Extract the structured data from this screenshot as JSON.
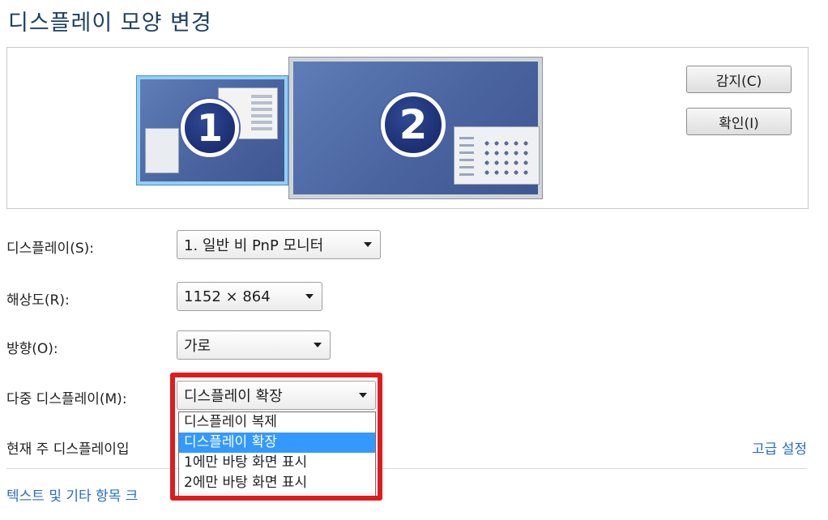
{
  "window": {
    "title": "디스플레이 모양 변경"
  },
  "preview": {
    "monitor1_number": "1",
    "monitor2_number": "2",
    "detect_label": "감지(C)",
    "identify_label": "확인(I)"
  },
  "settings": {
    "display_label": "디스플레이(S):",
    "display_value": "1. 일반 비 PnP 모니터",
    "resolution_label": "해상도(R):",
    "resolution_value": "1152 × 864",
    "orientation_label": "방향(O):",
    "orientation_value": "가로",
    "multi_label": "다중 디스플레이(M):",
    "multi_value": "디스플레이 확장",
    "multi_options": [
      "디스플레이 복제",
      "디스플레이 확장",
      "1에만 바탕 화면 표시",
      "2에만 바탕 화면 표시"
    ],
    "multi_selected_index": 1
  },
  "status": {
    "current_text": "현재 주 디스플레이입",
    "advanced_link": "고급 설정",
    "bottom_link": "텍스트 및 기타 항목 크"
  },
  "colors": {
    "title": "#1e3f66",
    "link": "#2a6cc4",
    "highlight_box": "#e11b1b",
    "menu_selected": "#3399ff",
    "monitor_fill": "#4a64a0"
  }
}
